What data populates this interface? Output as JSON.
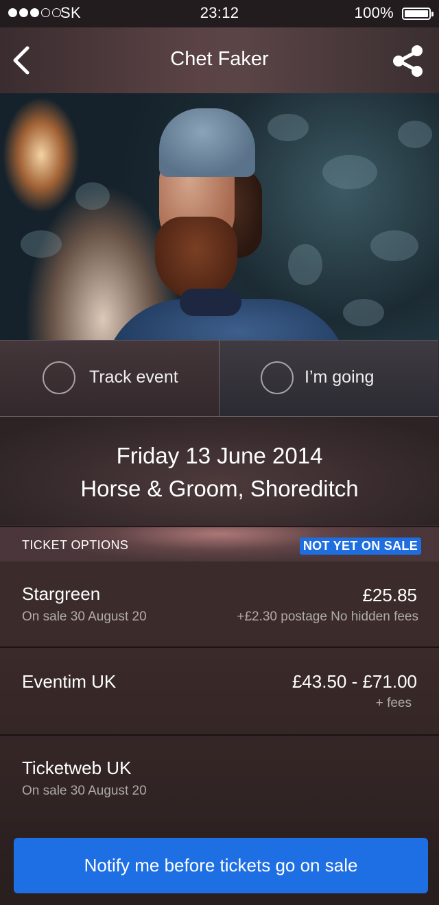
{
  "status_bar": {
    "signal_dots_filled": 3,
    "signal_dots_total": 5,
    "carrier": "SK",
    "time": "23:12",
    "battery_percent": "100%",
    "battery_level": 1.0
  },
  "nav": {
    "back_icon": "chevron-left-icon",
    "title": "Chet Faker",
    "share_icon": "share-icon"
  },
  "hero": {
    "image": "artist-photo"
  },
  "actions": {
    "track_label": "Track event",
    "going_label": "I’m going"
  },
  "event": {
    "date": "Friday 13 June 2014",
    "venue": "Horse & Groom, Shoreditch"
  },
  "tickets": {
    "header": "TICKET OPTIONS",
    "badge": "NOT YET ON SALE",
    "options": [
      {
        "name": "Stargreen",
        "sub": "On sale 30 August 20",
        "price": "£25.85",
        "note": "+£2.30 postage No hidden fees"
      },
      {
        "name": "Eventim UK",
        "sub": "",
        "price": "£43.50 - £71.00",
        "note": "+ fees"
      },
      {
        "name": "Ticketweb UK",
        "sub": "On sale 30 August 20",
        "price": "",
        "note": ""
      }
    ]
  },
  "cta": {
    "label": "Notify me before tickets go on sale"
  },
  "colors": {
    "accent": "#1e6fe3",
    "badge": "#1f6ee0"
  }
}
